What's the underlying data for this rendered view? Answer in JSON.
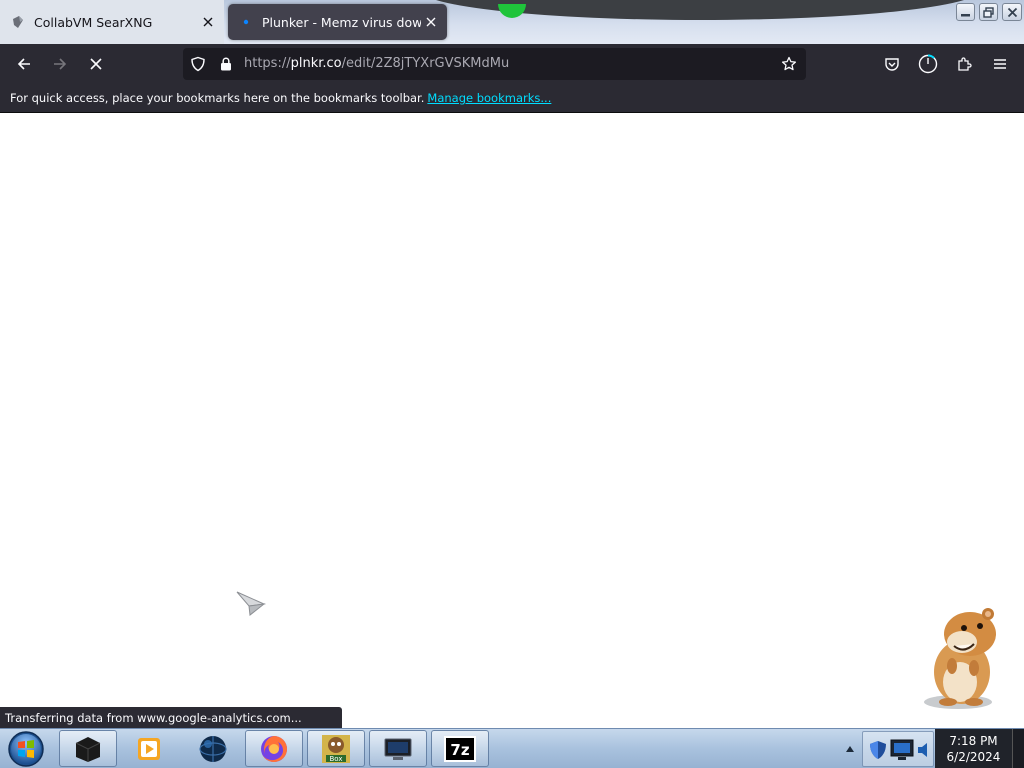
{
  "browser": {
    "tabs": [
      {
        "title": "CollabVM SearXNG",
        "favicon": "collabvm-icon",
        "active": false
      },
      {
        "title": "Plunker - Memz virus download",
        "favicon": "plunker-dot-icon",
        "active": true
      }
    ],
    "url": {
      "scheme": "https://",
      "host": "plnkr.co",
      "path": "/edit/2Z8jTYXrGVSKMdMu"
    },
    "bookmarks_bar": {
      "message": "For quick access, place your bookmarks here on the bookmarks toolbar.",
      "link": "Manage bookmarks..."
    },
    "status_text": "Transferring data from www.google-analytics.com..."
  },
  "taskbar": {
    "clock": {
      "time": "7:18 PM",
      "date": "6/2/2024"
    }
  },
  "colors": {
    "toolbar": "#2b2a33",
    "urlbar": "#1c1b22",
    "link": "#00ddff",
    "active_tab": "#42414d"
  }
}
